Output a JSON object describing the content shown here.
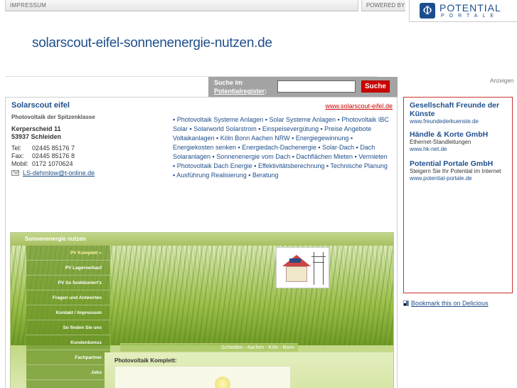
{
  "topbar": {
    "impressum": "IMPRESSUM",
    "powered_by": "POWERED BY",
    "logo_line1": "POTENTIAL",
    "logo_line2": "PORTALE",
    "logo_mark": "Φ"
  },
  "banner": {
    "domain": "solarscout-eifel-sonnenenergie-nutzen.de"
  },
  "search": {
    "label_line1": "Suche im",
    "label_line2": "Potentialregister",
    "label_colon": ":",
    "input_value": "",
    "button_label": "Suche"
  },
  "anzeigen": "Anzeigen",
  "company": {
    "name": "Solarscout eifel",
    "url": "www.solarscout-eifel.de",
    "subtitle": "Photovoltaik der Spitzenklasse",
    "street": "Kerperscheid 11",
    "city": "53937 Schleiden",
    "tel_label": "Tel:",
    "tel": "02445 85176 7",
    "fax_label": "Fax:",
    "fax": "02445 85176 8",
    "mobil_label": "Mobil:",
    "mobil": "0172 1070624",
    "email": "LS-dehmlow@t-online.de"
  },
  "keywords": "▪ Photovoltaik Systeme Anlagen ▪ Solar Systeme Anlagen ▪ Photovoltaik IBC Solar ▪ Solarworld Solarstrom ▪ Einspeisevergütung ▪ Preise Angebote Voltaikanlagen ▪ Köln Bonn Aachen NRW ▪ Energiegewinnung ▪ Energiekosten senken ▪ Energiedach-Dachenergie ▪ Solar-Dach ▪ Dach Solaranlagen ▪ Sonnenenergie vom Dach ▪ Dachflächen Mieten ▪ Vermieten ▪ Photovoltaik Dach Energie ▪ Effektivitätsberechnung ▪ Technische Planung ▪ Ausführung Realisierung ▪ Beratung",
  "site_preview": {
    "header": "Sonnenenergie nutzen",
    "nav": [
      "PV Komplett »",
      "PV Lagerverkauf",
      "PV So funktioniert's",
      "Fragen und Antworten",
      "Kontakt / Impressum",
      "So finden Sie uns",
      "Kundenbonus",
      "Fachpartner",
      "Jobs"
    ],
    "breadcrumb": "Schleiden - Aachen - Köln - Bonn",
    "content_title": "Photovoltaik Komplett:"
  },
  "ads": [
    {
      "title": "Gesellschaft Freunde der Künste",
      "desc": "",
      "url": "www.freundederkuenste.de"
    },
    {
      "title": "Händle & Korte GmbH",
      "desc": "Ethernet-Standleitungen",
      "url": "www.hk-net.de"
    },
    {
      "title": "Potential Portale GmbH",
      "desc": "Steigern Sie Ihr Potential im Internet",
      "url": "www.potential-portale.de"
    }
  ],
  "delicious": "Bookmark this on Delicious",
  "colors": {
    "accent": "#1f4f8c",
    "red": "#cc0000",
    "grey": "#a3a3a3"
  }
}
